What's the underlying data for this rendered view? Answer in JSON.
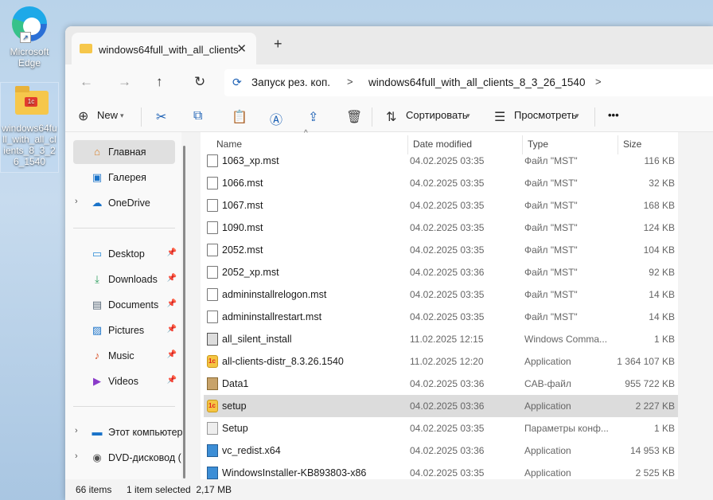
{
  "desktop": {
    "edge_label": "Microsoft Edge",
    "folder_label": "windows64full_with_all_clients_8_3_26_1540"
  },
  "tab": {
    "title": "windows64full_with_all_clients",
    "close": "✕",
    "new": "+"
  },
  "nav_buttons": {
    "back": "←",
    "forward": "→",
    "up": "↑",
    "refresh": "↻"
  },
  "address": {
    "root_label": "Запуск рез. коп.",
    "folder_label": "windows64full_with_all_clients_8_3_26_1540"
  },
  "toolbar": {
    "new_label": "New",
    "sort_label": "Сортировать",
    "view_label": "Просмотреть",
    "more_label": "•••"
  },
  "sidebar": {
    "top": [
      {
        "icon": "home-icon",
        "label": "Главная"
      },
      {
        "icon": "gallery-icon",
        "label": "Галерея"
      },
      {
        "icon": "onedrive-icon",
        "label": "OneDrive"
      }
    ],
    "pinned": [
      {
        "icon": "desktop-icon",
        "label": "Desktop"
      },
      {
        "icon": "downloads-icon",
        "label": "Downloads"
      },
      {
        "icon": "documents-icon",
        "label": "Documents"
      },
      {
        "icon": "pictures-icon",
        "label": "Pictures"
      },
      {
        "icon": "music-icon",
        "label": "Music"
      },
      {
        "icon": "videos-icon",
        "label": "Videos"
      }
    ],
    "bottom": [
      {
        "icon": "computer-icon",
        "label": "Этот компьютер"
      },
      {
        "icon": "dvd-icon",
        "label": "DVD-дисковод ("
      }
    ]
  },
  "columns": {
    "name": "Name",
    "date": "Date modified",
    "type": "Type",
    "size": "Size"
  },
  "files": [
    {
      "icon": "doc",
      "name": "1063_xp.mst",
      "date": "04.02.2025 03:35",
      "type": "Файл \"MST\"",
      "size": "116 KB"
    },
    {
      "icon": "doc",
      "name": "1066.mst",
      "date": "04.02.2025 03:35",
      "type": "Файл \"MST\"",
      "size": "32 KB"
    },
    {
      "icon": "doc",
      "name": "1067.mst",
      "date": "04.02.2025 03:35",
      "type": "Файл \"MST\"",
      "size": "168 KB"
    },
    {
      "icon": "doc",
      "name": "1090.mst",
      "date": "04.02.2025 03:35",
      "type": "Файл \"MST\"",
      "size": "124 KB"
    },
    {
      "icon": "doc",
      "name": "2052.mst",
      "date": "04.02.2025 03:35",
      "type": "Файл \"MST\"",
      "size": "104 KB"
    },
    {
      "icon": "doc",
      "name": "2052_xp.mst",
      "date": "04.02.2025 03:36",
      "type": "Файл \"MST\"",
      "size": "92 KB"
    },
    {
      "icon": "doc",
      "name": "admininstallrelogon.mst",
      "date": "04.02.2025 03:35",
      "type": "Файл \"MST\"",
      "size": "14 KB"
    },
    {
      "icon": "doc",
      "name": "admininstallrestart.mst",
      "date": "04.02.2025 03:35",
      "type": "Файл \"MST\"",
      "size": "14 KB"
    },
    {
      "icon": "cmd",
      "name": "all_silent_install",
      "date": "11.02.2025 12:15",
      "type": "Windows Comma...",
      "size": "1 KB"
    },
    {
      "icon": "app",
      "name": "all-clients-distr_8.3.26.1540",
      "date": "11.02.2025 12:20",
      "type": "Application",
      "size": "1 364 107 KB"
    },
    {
      "icon": "cab",
      "name": "Data1",
      "date": "04.02.2025 03:36",
      "type": "CAB-файл",
      "size": "955 722 KB"
    },
    {
      "icon": "app",
      "name": "setup",
      "date": "04.02.2025 03:36",
      "type": "Application",
      "size": "2 227 KB",
      "selected": true
    },
    {
      "icon": "set",
      "name": "Setup",
      "date": "04.02.2025 03:35",
      "type": "Параметры конф...",
      "size": "1 KB"
    },
    {
      "icon": "inst",
      "name": "vc_redist.x64",
      "date": "04.02.2025 03:36",
      "type": "Application",
      "size": "14 953 KB"
    },
    {
      "icon": "inst",
      "name": "WindowsInstaller-KB893803-x86",
      "date": "04.02.2025 03:35",
      "type": "Application",
      "size": "2 525 KB"
    }
  ],
  "status": {
    "count": "66 items",
    "selection": "1 item selected  2,17 MB"
  }
}
